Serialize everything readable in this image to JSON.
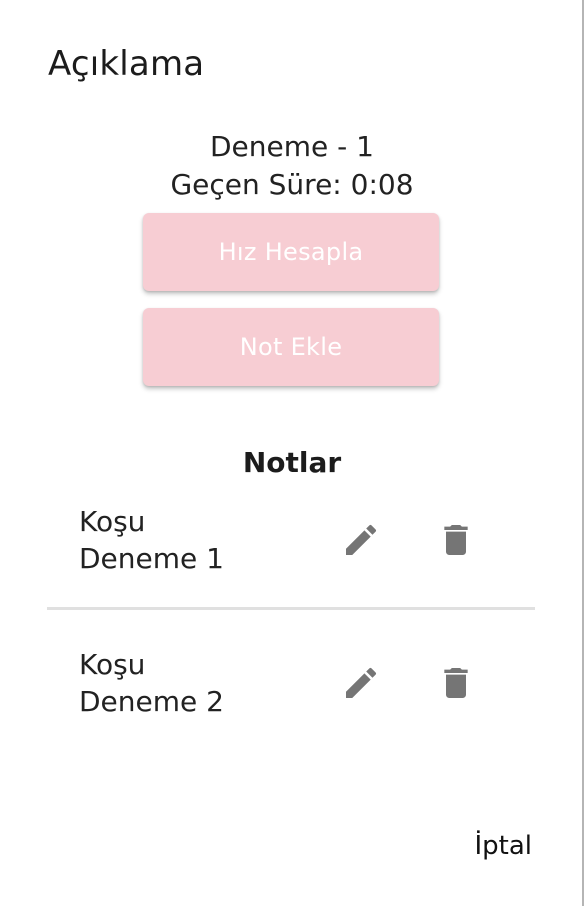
{
  "dialog": {
    "title": "Açıklama",
    "trial_label": "Deneme - 1",
    "elapsed_label": "Geçen Süre: 0:08",
    "buttons": {
      "calculate_speed": "Hız Hesapla",
      "add_note": "Not Ekle"
    },
    "notes_section": {
      "title": "Notlar",
      "items": [
        {
          "line1": "Koşu",
          "line2": "Deneme 1"
        },
        {
          "line1": "Koşu",
          "line2": "Deneme 2"
        }
      ]
    },
    "cancel_label": "İptal"
  },
  "colors": {
    "button_bg": "#f7cdd3",
    "icon_gray": "#757575",
    "divider": "#e0e0e0"
  },
  "icons": {
    "edit": "edit-icon",
    "delete": "delete-icon"
  }
}
